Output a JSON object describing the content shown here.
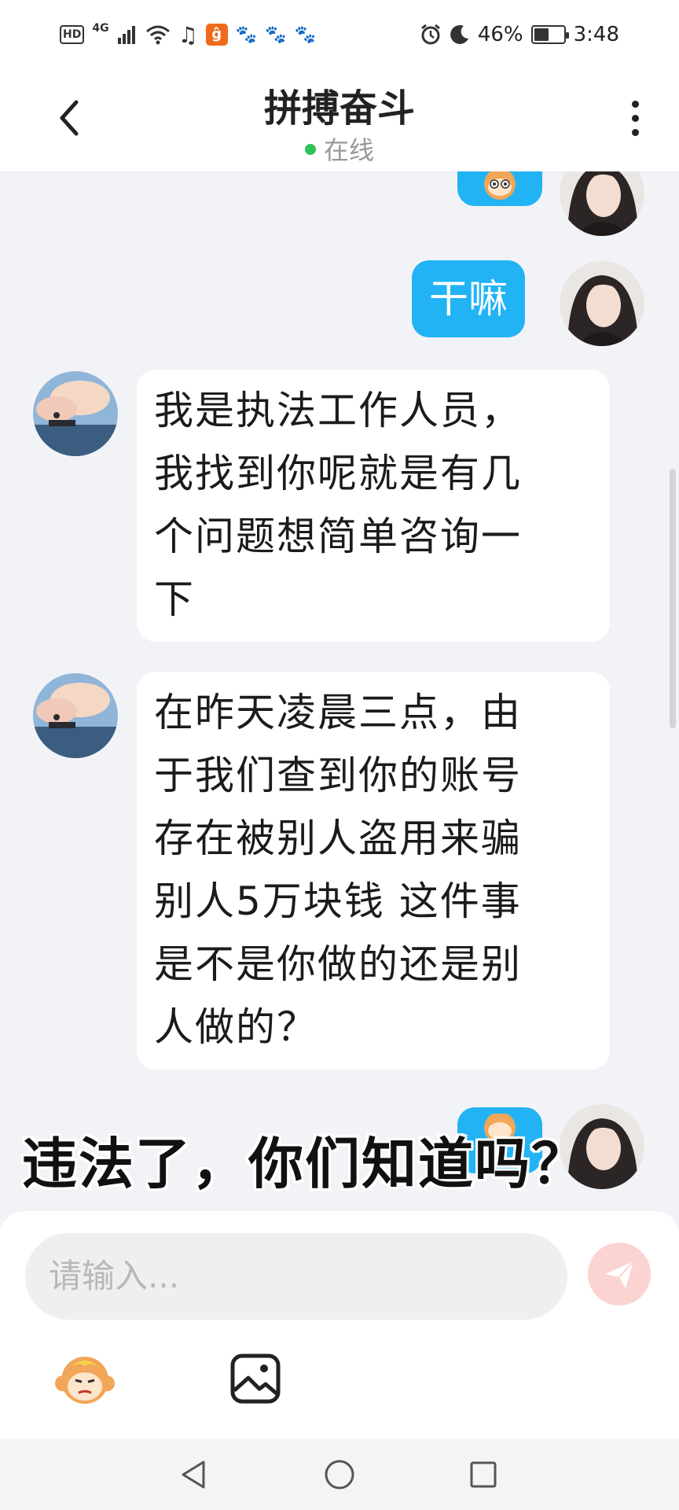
{
  "status_bar": {
    "left_badges": [
      "HD",
      "4G"
    ],
    "app_badge": "ĝ",
    "battery_text": "46%",
    "time": "3:48"
  },
  "header": {
    "title": "拼搏奋斗",
    "status": "在线",
    "status_color": "#2fc25b"
  },
  "messages": [
    {
      "from": "self",
      "type": "emoji",
      "icon": "monkey-sticker-icon"
    },
    {
      "from": "self",
      "type": "text",
      "text": "干嘛"
    },
    {
      "from": "other",
      "type": "text",
      "lines": [
        "我是执法工作人员，",
        "我找到你呢就是有几",
        "个问题想简单咨询一",
        "下"
      ]
    },
    {
      "from": "other",
      "type": "text",
      "lines": [
        "在昨天凌晨三点，由",
        "于我们查到你的账号",
        "存在被别人盗用来骗",
        "别人5万块钱 这件事",
        "是不是你做的还是别",
        "人做的？"
      ]
    },
    {
      "from": "self",
      "type": "emoji",
      "icon": "monkey-sticker-icon"
    }
  ],
  "overlay_caption": "违法了，你们知道吗？",
  "input": {
    "placeholder": "请输入..."
  },
  "colors": {
    "accent_blue": "#22b3f5",
    "send_button": "#fbd4d1",
    "background": "#f2f3f7"
  }
}
